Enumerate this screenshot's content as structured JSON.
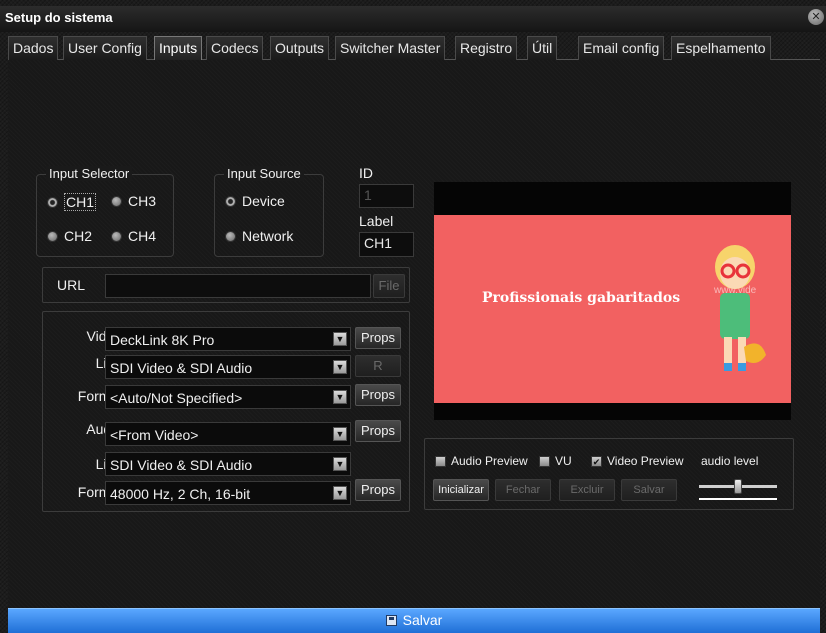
{
  "window": {
    "title": "Setup do sistema",
    "close_glyph": "✕"
  },
  "tabs": [
    {
      "label": "Dados"
    },
    {
      "label": "User Config"
    },
    {
      "label": "Inputs",
      "active": true
    },
    {
      "label": "Codecs"
    },
    {
      "label": "Outputs"
    },
    {
      "label": "Switcher Master"
    },
    {
      "label": "Registro"
    },
    {
      "label": "Útil"
    },
    {
      "label": "Email config"
    },
    {
      "label": "Espelhamento"
    }
  ],
  "input_selector": {
    "title": "Input Selector",
    "options": [
      "CH1",
      "CH3",
      "CH2",
      "CH4"
    ],
    "selected": "CH1"
  },
  "input_source": {
    "title": "Input Source",
    "options": [
      "Device",
      "Network"
    ],
    "selected": "Device"
  },
  "id_field": {
    "label": "ID",
    "value": "1"
  },
  "label_field": {
    "label": "Label",
    "value": "CH1"
  },
  "url": {
    "label": "URL",
    "value": "",
    "file_button": "File"
  },
  "video_section": {
    "video": {
      "label": "Video:",
      "value": "DeckLink 8K Pro",
      "props": "Props"
    },
    "line": {
      "label": "Line:",
      "value": "SDI Video & SDI Audio",
      "button": "R"
    },
    "format": {
      "label": "Format:",
      "value": "<Auto/Not Specified>",
      "props": "Props"
    }
  },
  "audio_section": {
    "audio": {
      "label": "Audio:",
      "value": "<From Video>",
      "props": "Props"
    },
    "line": {
      "label": "Line:",
      "value": "SDI Video & SDI Audio"
    },
    "format": {
      "label": "Format:",
      "value": "48000 Hz, 2 Ch, 16-bit",
      "props": "Props"
    }
  },
  "preview": {
    "slide_text": "Profissionais gabaritados",
    "watermark": "www.vide"
  },
  "preview_controls": {
    "audio_preview": {
      "label": "Audio Preview",
      "checked": false
    },
    "vu": {
      "label": "VU",
      "checked": false
    },
    "video_preview": {
      "label": "Video Preview",
      "checked": true
    },
    "audio_level_label": "audio level",
    "audio_level": 0.5,
    "buttons": {
      "start": "Inicializar",
      "close": "Fechar",
      "delete": "Excluir",
      "save": "Salvar"
    }
  },
  "footer": {
    "save_label": "Salvar"
  },
  "colors": {
    "accent": "#2f86ee",
    "slide_bg": "#f26161",
    "background": "#1a1a1a"
  }
}
